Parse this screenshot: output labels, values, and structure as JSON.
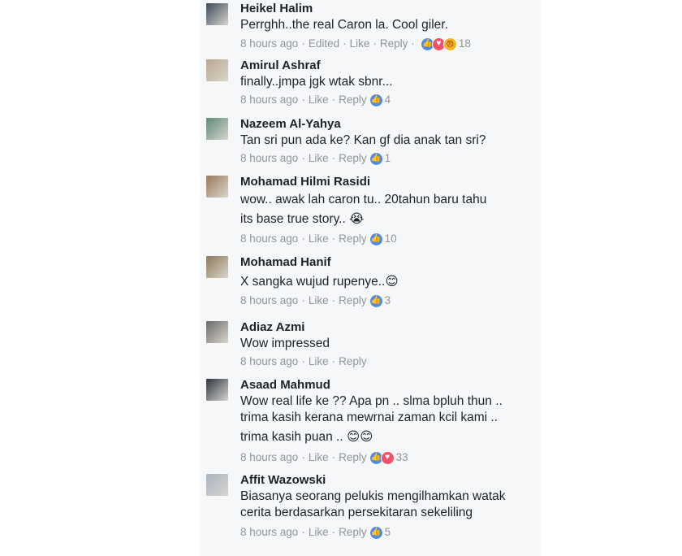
{
  "comments": [
    {
      "author": "Heikel Halim",
      "lines": [
        "Perrghh..the real Caron la. Cool giler."
      ],
      "time": "8 hours ago",
      "edited": "Edited",
      "like": "Like",
      "reply": "Reply",
      "reactions": [
        "like",
        "love",
        "angry"
      ],
      "count": "18",
      "avatar_color": "#3a4a5c"
    },
    {
      "author": "Amirul Ashraf",
      "lines": [
        "finally..jmpa jgk wtak sbnr..."
      ],
      "time": "8 hours ago",
      "like": "Like",
      "reply": "Reply",
      "reactions": [
        "like"
      ],
      "count": "4",
      "avatar_color": "#b9a890"
    },
    {
      "author": "Nazeem Al-Yahya",
      "lines": [
        "Tan sri pun ada ke? Kan gf dia anak tan sri?"
      ],
      "time": "8 hours ago",
      "like": "Like",
      "reply": "Reply",
      "reactions": [
        "like"
      ],
      "count": "1",
      "avatar_color": "#5d8a7a"
    },
    {
      "author": "Mohamad Hilmi Rasidi",
      "lines": [
        "wow.. awak lah caron tu.. 20tahun baru tahu",
        "its base true story.. 😭"
      ],
      "time": "8 hours ago",
      "like": "Like",
      "reply": "Reply",
      "reactions": [
        "like"
      ],
      "count": "10",
      "avatar_color": "#9a7b5e"
    },
    {
      "author": "Mohamad Hanif",
      "lines": [
        "X sangka wujud rupenye..😊"
      ],
      "time": "8 hours ago",
      "like": "Like",
      "reply": "Reply",
      "reactions": [
        "like"
      ],
      "count": "3",
      "avatar_color": "#8c7a5a"
    },
    {
      "author": "Adiaz Azmi",
      "lines": [
        "Wow impressed"
      ],
      "time": "8 hours ago",
      "like": "Like",
      "reply": "Reply",
      "reactions": [],
      "count": "",
      "avatar_color": "#6a6a6a"
    },
    {
      "author": "Asaad Mahmud",
      "lines": [
        "Wow real life ke ?? Apa pn .. slma bpluh thun ..",
        "trima kasih kerana mewrnai zaman kcil kami ..",
        "trima kasih puan .. 😊😊"
      ],
      "time": "8 hours ago",
      "like": "Like",
      "reply": "Reply",
      "reactions": [
        "like",
        "love"
      ],
      "count": "33",
      "avatar_color": "#2c3540"
    },
    {
      "author": "Affit Wazowski",
      "lines": [
        "Biasanya seorang pelukis mengilhamkan watak",
        "cerita berdasarkan persekitaran sekeliling"
      ],
      "time": "8 hours ago",
      "like": "Like",
      "reply": "Reply",
      "reactions": [
        "like"
      ],
      "count": "5",
      "avatar_color": "#a9b4c2"
    }
  ]
}
